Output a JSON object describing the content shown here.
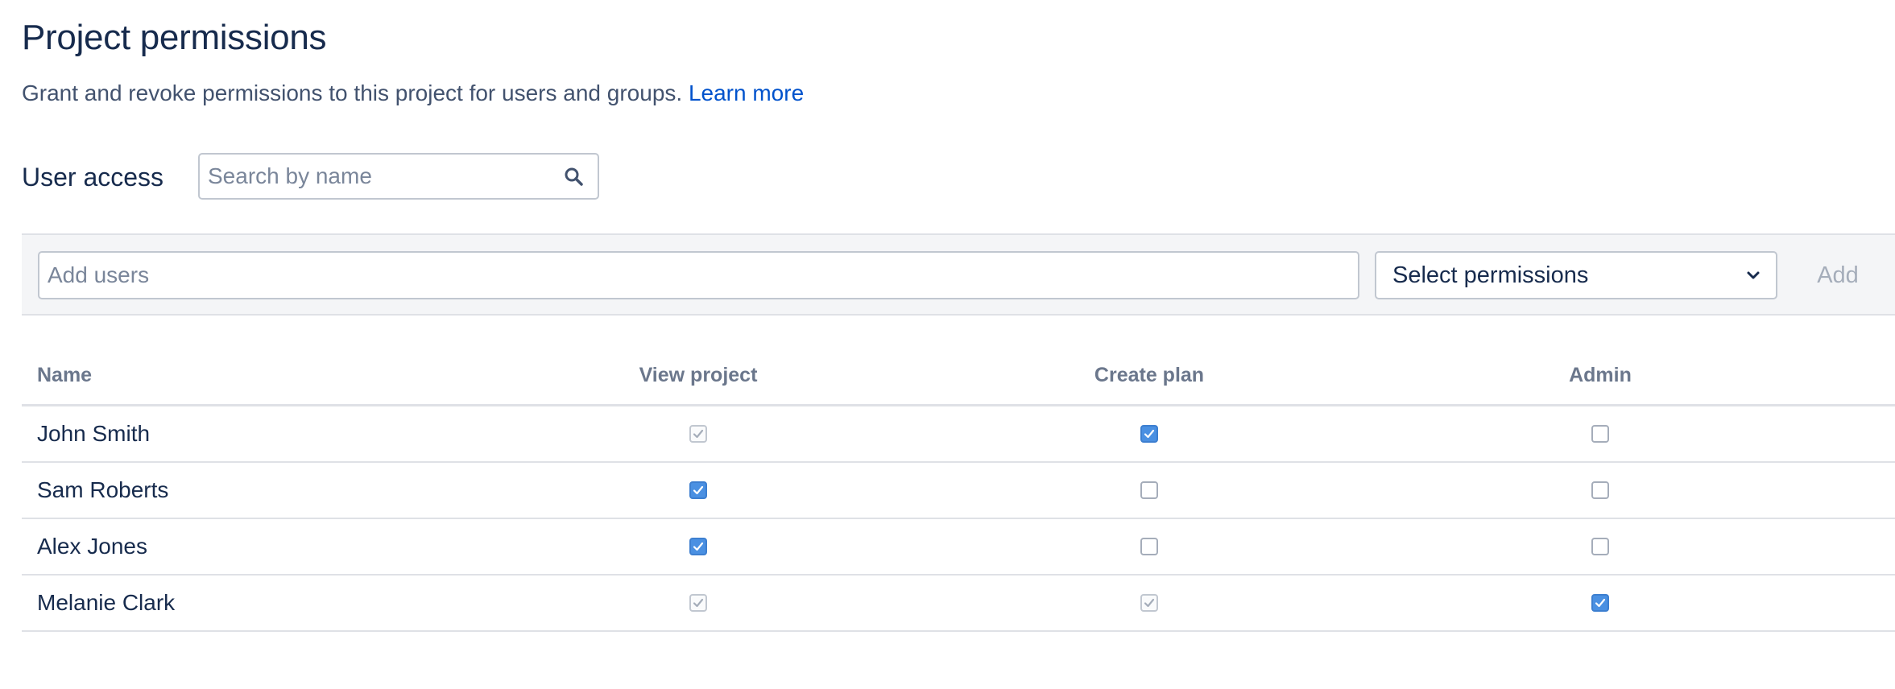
{
  "header": {
    "title": "Project permissions",
    "description": "Grant and revoke permissions to this project for users and groups.",
    "learn_more": "Learn more"
  },
  "user_access": {
    "label": "User access",
    "search_placeholder": "Search by name",
    "search_icon": "search-icon"
  },
  "add_panel": {
    "users_placeholder": "Add users",
    "permissions_select": "Select permissions",
    "add_label": "Add"
  },
  "table": {
    "columns": [
      "Name",
      "View project",
      "Create plan",
      "Admin"
    ],
    "rows": [
      {
        "name": "John Smith",
        "view_project": "disabled-checked",
        "create_plan": "checked",
        "admin": "unchecked"
      },
      {
        "name": "Sam Roberts",
        "view_project": "checked",
        "create_plan": "unchecked",
        "admin": "unchecked"
      },
      {
        "name": "Alex Jones",
        "view_project": "checked",
        "create_plan": "unchecked",
        "admin": "unchecked"
      },
      {
        "name": "Melanie Clark",
        "view_project": "disabled-checked",
        "create_plan": "disabled-checked",
        "admin": "checked"
      }
    ]
  },
  "colors": {
    "accent": "#4a90e2",
    "link": "#0052cc",
    "text": "#172b4d",
    "muted": "#6b778c",
    "panel": "#f4f5f7"
  }
}
